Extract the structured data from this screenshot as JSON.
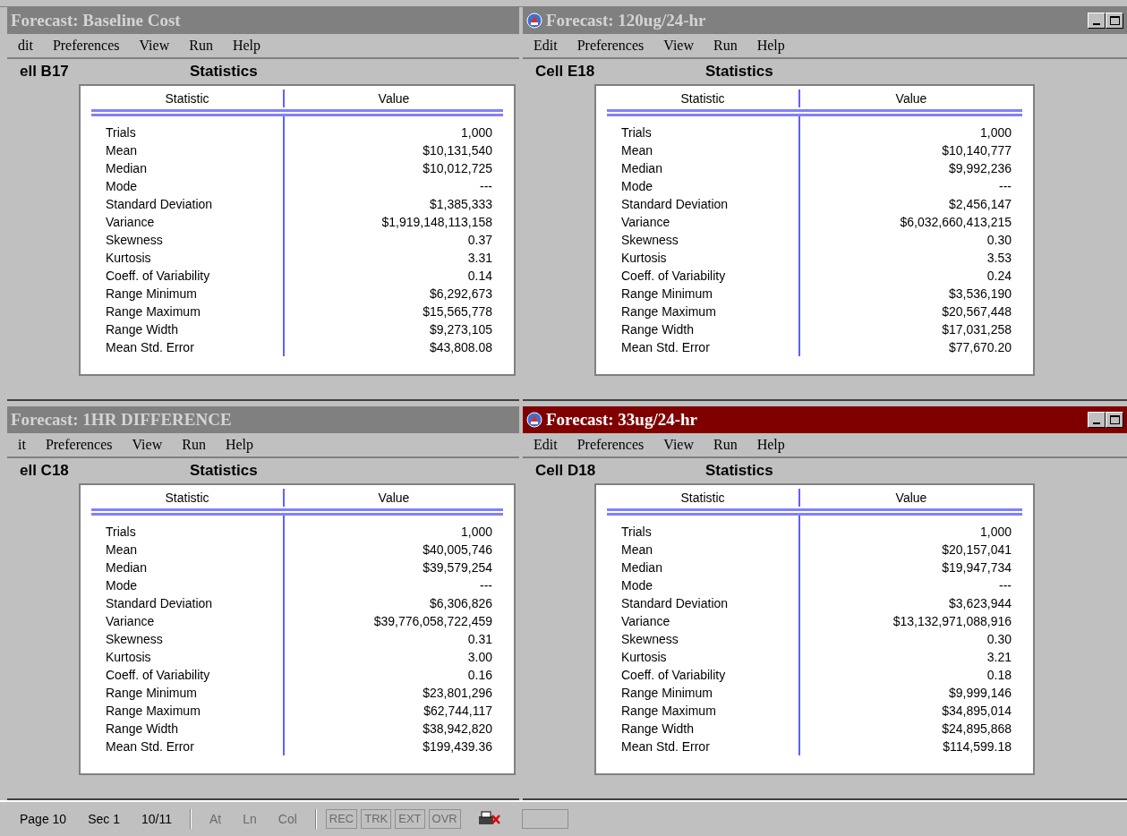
{
  "windows": [
    {
      "title": "Forecast: Baseline Cost",
      "active": false,
      "window_buttons": false,
      "icon": false,
      "menu": [
        "dit",
        "Preferences",
        "View",
        "Run",
        "Help"
      ],
      "cell": "ell B17",
      "heading": "Statistics",
      "columns": [
        "Statistic",
        "Value"
      ],
      "rows": [
        {
          "statistic": "Trials",
          "value": "1,000"
        },
        {
          "statistic": "Mean",
          "value": "$10,131,540"
        },
        {
          "statistic": "Median",
          "value": "$10,012,725"
        },
        {
          "statistic": "Mode",
          "value": "---"
        },
        {
          "statistic": "Standard Deviation",
          "value": "$1,385,333"
        },
        {
          "statistic": "Variance",
          "value": "$1,919,148,113,158"
        },
        {
          "statistic": "Skewness",
          "value": "0.37"
        },
        {
          "statistic": "Kurtosis",
          "value": "3.31"
        },
        {
          "statistic": "Coeff. of Variability",
          "value": "0.14"
        },
        {
          "statistic": "Range Minimum",
          "value": "$6,292,673"
        },
        {
          "statistic": "Range Maximum",
          "value": "$15,565,778"
        },
        {
          "statistic": "Range Width",
          "value": "$9,273,105"
        },
        {
          "statistic": "Mean Std. Error",
          "value": "$43,808.08"
        }
      ]
    },
    {
      "title": "Forecast: 120ug/24-hr",
      "active": false,
      "window_buttons": true,
      "icon": true,
      "menu": [
        "Edit",
        "Preferences",
        "View",
        "Run",
        "Help"
      ],
      "cell": "Cell E18",
      "heading": "Statistics",
      "columns": [
        "Statistic",
        "Value"
      ],
      "rows": [
        {
          "statistic": "Trials",
          "value": "1,000"
        },
        {
          "statistic": "Mean",
          "value": "$10,140,777"
        },
        {
          "statistic": "Median",
          "value": "$9,992,236"
        },
        {
          "statistic": "Mode",
          "value": "---"
        },
        {
          "statistic": "Standard Deviation",
          "value": "$2,456,147"
        },
        {
          "statistic": "Variance",
          "value": "$6,032,660,413,215"
        },
        {
          "statistic": "Skewness",
          "value": "0.30"
        },
        {
          "statistic": "Kurtosis",
          "value": "3.53"
        },
        {
          "statistic": "Coeff. of Variability",
          "value": "0.24"
        },
        {
          "statistic": "Range Minimum",
          "value": "$3,536,190"
        },
        {
          "statistic": "Range Maximum",
          "value": "$20,567,448"
        },
        {
          "statistic": "Range Width",
          "value": "$17,031,258"
        },
        {
          "statistic": "Mean Std. Error",
          "value": "$77,670.20"
        }
      ]
    },
    {
      "title": "Forecast: 1HR DIFFERENCE",
      "active": false,
      "window_buttons": false,
      "icon": false,
      "menu": [
        "it",
        "Preferences",
        "View",
        "Run",
        "Help"
      ],
      "cell": "ell C18",
      "heading": "Statistics",
      "columns": [
        "Statistic",
        "Value"
      ],
      "rows": [
        {
          "statistic": "Trials",
          "value": "1,000"
        },
        {
          "statistic": "Mean",
          "value": "$40,005,746"
        },
        {
          "statistic": "Median",
          "value": "$39,579,254"
        },
        {
          "statistic": "Mode",
          "value": "---"
        },
        {
          "statistic": "Standard Deviation",
          "value": "$6,306,826"
        },
        {
          "statistic": "Variance",
          "value": "$39,776,058,722,459"
        },
        {
          "statistic": "Skewness",
          "value": "0.31"
        },
        {
          "statistic": "Kurtosis",
          "value": "3.00"
        },
        {
          "statistic": "Coeff. of Variability",
          "value": "0.16"
        },
        {
          "statistic": "Range Minimum",
          "value": "$23,801,296"
        },
        {
          "statistic": "Range Maximum",
          "value": "$62,744,117"
        },
        {
          "statistic": "Range Width",
          "value": "$38,942,820"
        },
        {
          "statistic": "Mean Std. Error",
          "value": "$199,439.36"
        }
      ]
    },
    {
      "title": "Forecast: 33ug/24-hr",
      "active": true,
      "window_buttons": true,
      "icon": true,
      "menu": [
        "Edit",
        "Preferences",
        "View",
        "Run",
        "Help"
      ],
      "cell": "Cell D18",
      "heading": "Statistics",
      "columns": [
        "Statistic",
        "Value"
      ],
      "rows": [
        {
          "statistic": "Trials",
          "value": "1,000"
        },
        {
          "statistic": "Mean",
          "value": "$20,157,041"
        },
        {
          "statistic": "Median",
          "value": "$19,947,734"
        },
        {
          "statistic": "Mode",
          "value": "---"
        },
        {
          "statistic": "Standard Deviation",
          "value": "$3,623,944"
        },
        {
          "statistic": "Variance",
          "value": "$13,132,971,088,916"
        },
        {
          "statistic": "Skewness",
          "value": "0.30"
        },
        {
          "statistic": "Kurtosis",
          "value": "3.21"
        },
        {
          "statistic": "Coeff. of Variability",
          "value": "0.18"
        },
        {
          "statistic": "Range Minimum",
          "value": "$9,999,146"
        },
        {
          "statistic": "Range Maximum",
          "value": "$34,895,014"
        },
        {
          "statistic": "Range Width",
          "value": "$24,895,868"
        },
        {
          "statistic": "Mean Std. Error",
          "value": "$114,599.18"
        }
      ]
    }
  ],
  "status_bar": [
    {
      "kind": "text",
      "label": "Page 10",
      "disabled": false
    },
    {
      "kind": "text",
      "label": "Sec 1",
      "disabled": false
    },
    {
      "kind": "text",
      "label": "10/11",
      "disabled": false
    },
    {
      "kind": "separator"
    },
    {
      "kind": "text",
      "label": "At",
      "disabled": true
    },
    {
      "kind": "text",
      "label": "Ln",
      "disabled": true
    },
    {
      "kind": "text",
      "label": "Col",
      "disabled": true
    },
    {
      "kind": "separator"
    },
    {
      "kind": "box",
      "label": "REC",
      "disabled": true
    },
    {
      "kind": "box",
      "label": "TRK",
      "disabled": true
    },
    {
      "kind": "box",
      "label": "EXT",
      "disabled": true
    },
    {
      "kind": "box",
      "label": "OVR",
      "disabled": true
    },
    {
      "kind": "icon"
    },
    {
      "kind": "empty"
    }
  ]
}
